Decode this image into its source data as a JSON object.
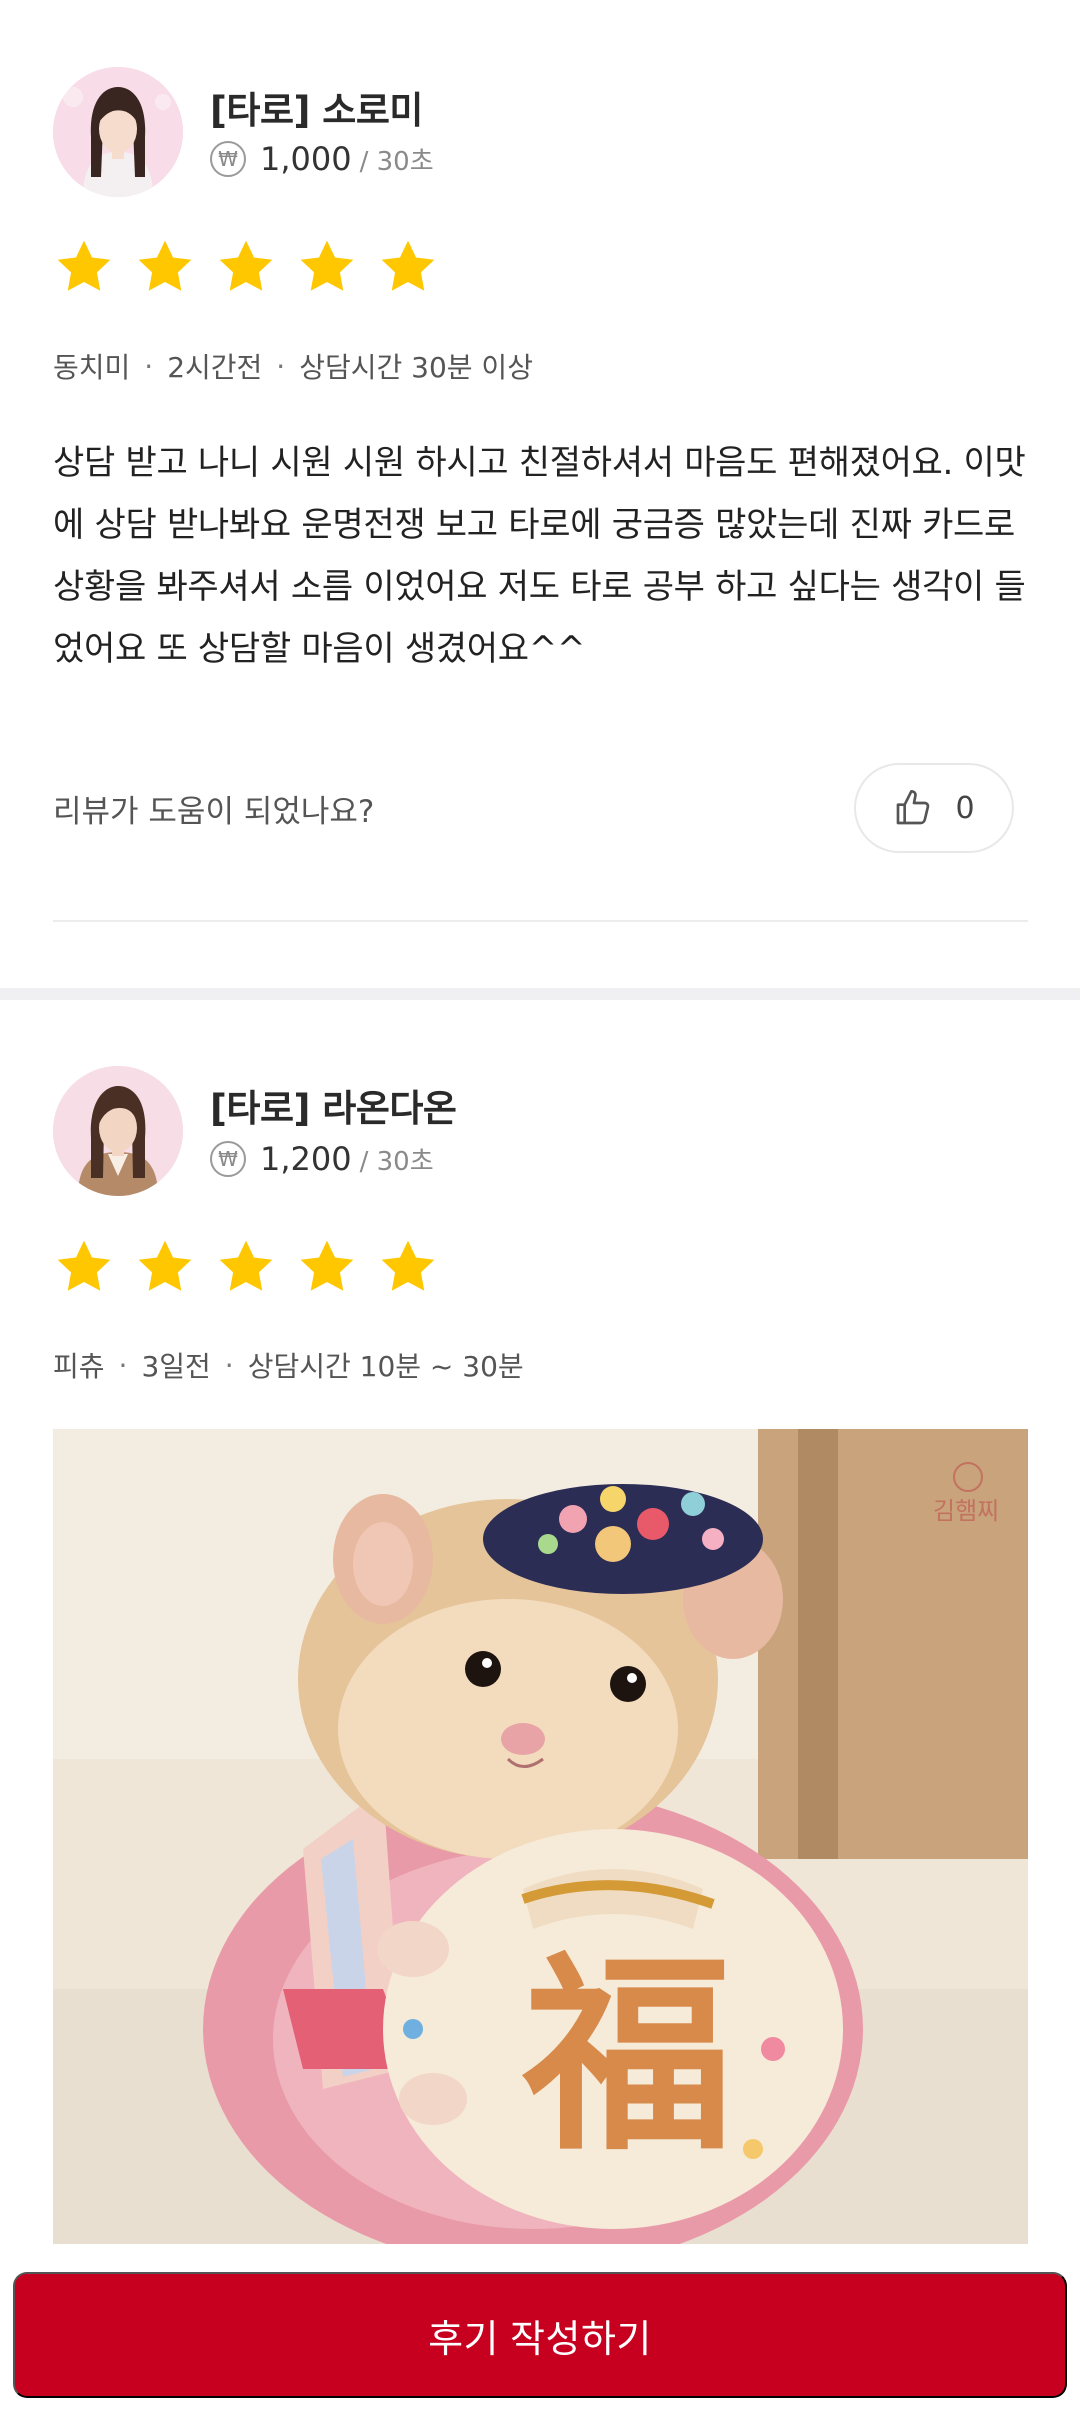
{
  "reviews": [
    {
      "counselor": {
        "name": "[타로] 소로미",
        "currency_symbol": "₩",
        "price": "1,000",
        "price_unit": "/ 30초"
      },
      "rating": 5,
      "meta": {
        "author": "동치미",
        "time_ago": "2시간전",
        "duration": "상담시간 30분 이상"
      },
      "text": "상담 받고 나니 시원 시원 하시고 친절하셔서 마음도 편해졌어요. 이맛에 상담 받나봐요 운명전쟁 보고 타로에 궁금증 많았는데 진짜 카드로 상황을 봐주셔서 소름 이었어요 저도 타로 공부 하고 싶다는 생각이 들었어요 또 상담할 마음이 생겼어요^^",
      "helpful_question": "리뷰가 도움이 되었나요?",
      "like_count": "0"
    },
    {
      "counselor": {
        "name": "[타로] 라온다온",
        "currency_symbol": "₩",
        "price": "1,200",
        "price_unit": "/ 30초"
      },
      "rating": 5,
      "meta": {
        "author": "피츄",
        "time_ago": "3일전",
        "duration": "상담시간 10분 ~ 30분"
      },
      "photo_watermark": "김햄찌"
    }
  ],
  "colors": {
    "star": "#FFC700",
    "cta": "#C8001F",
    "section_gap": "#F0F0F3"
  },
  "icons": {
    "price": "won-coin-icon",
    "like": "thumbs-up-icon",
    "rating": "star-icon"
  },
  "cta": {
    "label": "후기 작성하기"
  }
}
